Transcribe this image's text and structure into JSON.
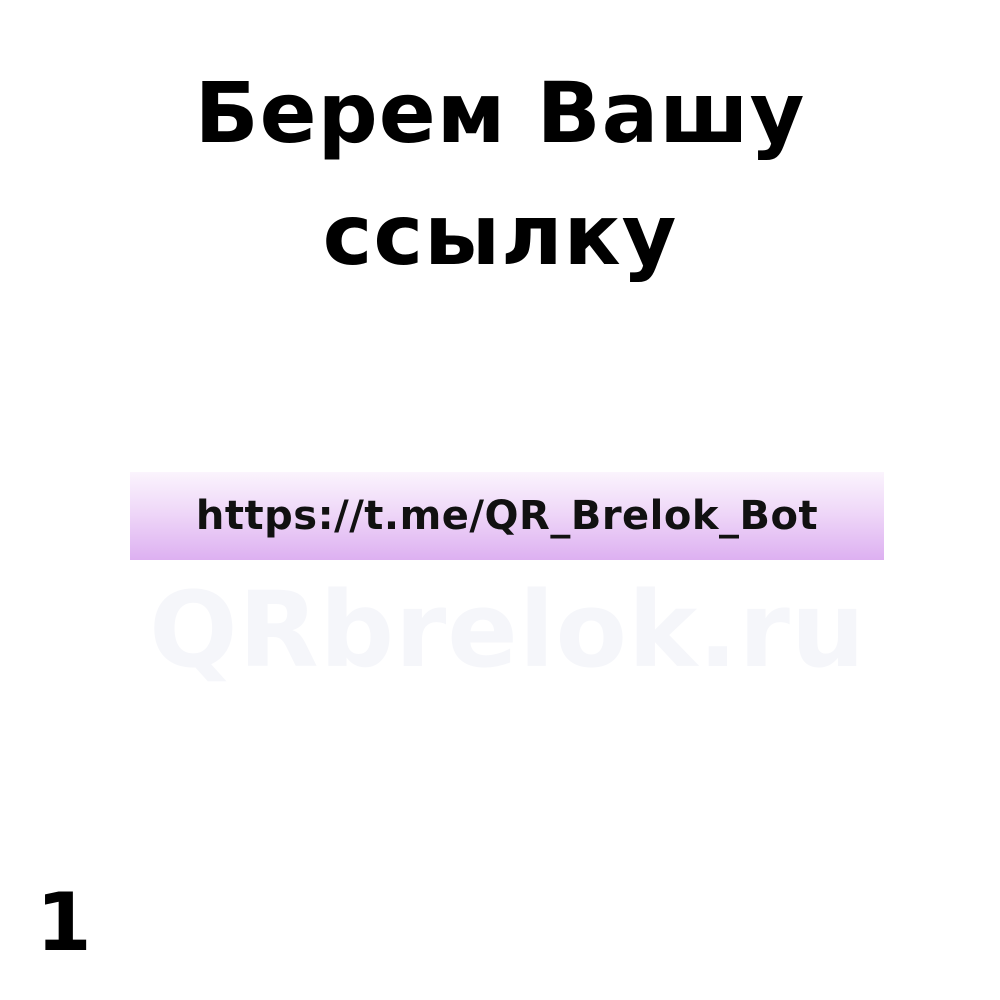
{
  "headline": {
    "line1": "Берем Вашу",
    "line2": "ссылку"
  },
  "link": {
    "text": "https://t.me/QR_Brelok_Bot"
  },
  "watermark": {
    "text": "QRbrelok.ru"
  },
  "page_number": "1",
  "colors": {
    "background": "#ffffff",
    "text": "#000000",
    "link_bar_light": "#fbf4fd",
    "link_bar_dark": "#ddb0f1",
    "watermark": "#f5f6fa"
  }
}
